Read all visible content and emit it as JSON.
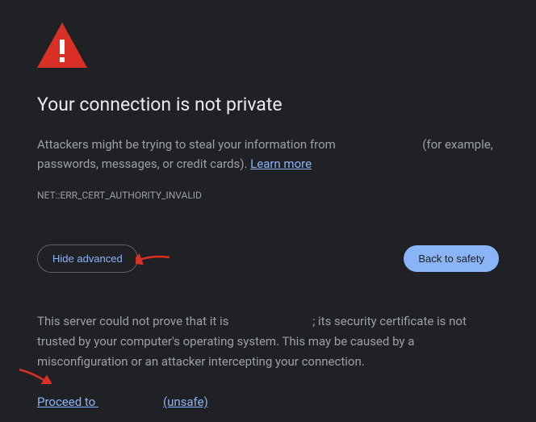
{
  "heading": "Your connection is not private",
  "description_part1": "Attackers might be trying to steal your information from ",
  "description_part2": " (for example, passwords, messages, or credit cards). ",
  "learn_more_label": "Learn more",
  "error_code": "NET::ERR_CERT_AUTHORITY_INVALID",
  "hide_advanced_label": "Hide advanced",
  "back_to_safety_label": "Back to safety",
  "advanced_part1": "This server could not prove that it is ",
  "advanced_part2": "; its security certificate is not trusted by your computer's operating system. This may be caused by a misconfiguration or an attacker intercepting your connection.",
  "proceed_prefix": "Proceed to ",
  "proceed_suffix": "(unsafe)"
}
